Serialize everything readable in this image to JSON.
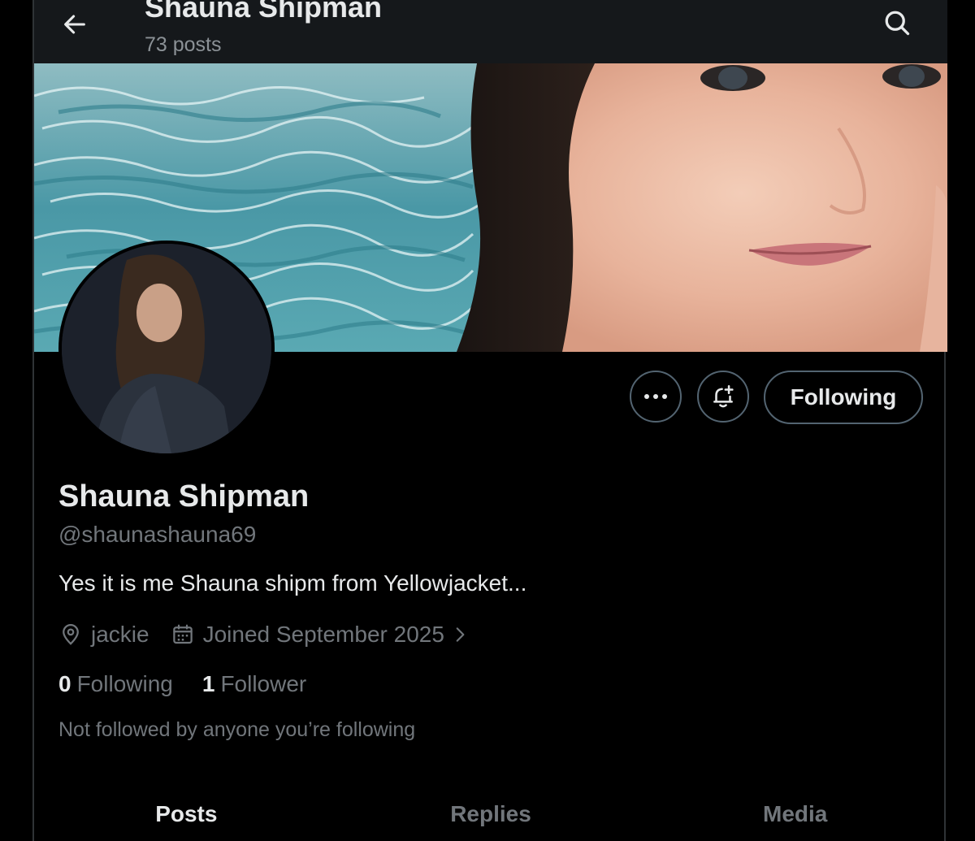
{
  "header": {
    "title": "Shauna Shipman",
    "posts_count": "73 posts",
    "back_icon": "arrow-left-icon",
    "search_icon": "search-icon"
  },
  "profile": {
    "display_name": "Shauna Shipman",
    "handle": "@shaunashauna69",
    "bio": "Yes it is me Shauna shipm from Yellowjacket...",
    "location": "jackie",
    "joined": "Joined September 2025",
    "following_count": "0",
    "following_label": "Following",
    "followers_count": "1",
    "followers_label": "Follower",
    "followed_by": "Not followed by anyone you’re following"
  },
  "actions": {
    "following_label": "Following",
    "more_icon": "more-horizontal-icon",
    "notify_icon": "bell-plus-icon"
  },
  "tabs": [
    {
      "label": "Posts",
      "active": true
    },
    {
      "label": "Replies",
      "active": false
    },
    {
      "label": "Media",
      "active": false
    }
  ],
  "colors": {
    "background": "#000000",
    "text_primary": "#e7e9ea",
    "text_secondary": "#71767b",
    "border": "#536471"
  }
}
